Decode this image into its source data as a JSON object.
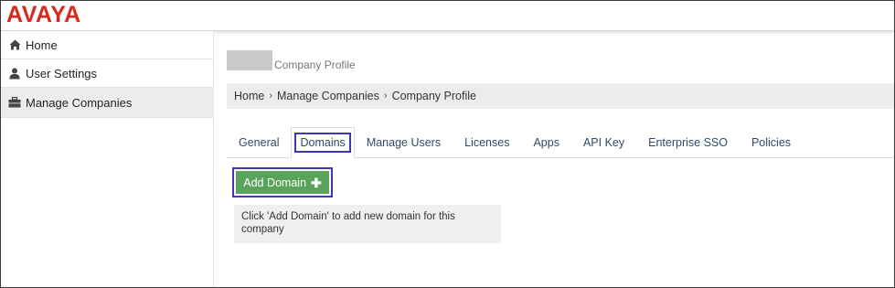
{
  "brand": {
    "logo_text": "AVAYA",
    "accent": "#da291c"
  },
  "sidebar": {
    "items": [
      {
        "label": "Home",
        "icon": "home-icon"
      },
      {
        "label": "User Settings",
        "icon": "user-icon"
      },
      {
        "label": "Manage Companies",
        "icon": "briefcase-icon",
        "active": true
      }
    ]
  },
  "header": {
    "company_title": "Company Profile"
  },
  "breadcrumb": {
    "items": [
      "Home",
      "Manage Companies",
      "Company Profile"
    ],
    "separator": "›"
  },
  "tabs": [
    {
      "label": "General"
    },
    {
      "label": "Domains",
      "active": true
    },
    {
      "label": "Manage Users"
    },
    {
      "label": "Licenses"
    },
    {
      "label": "Apps"
    },
    {
      "label": "API Key"
    },
    {
      "label": "Enterprise SSO"
    },
    {
      "label": "Policies"
    }
  ],
  "domains": {
    "add_button_label": "Add Domain",
    "add_button_icon": "plus-icon",
    "button_color": "#5aa35a",
    "highlight_color": "#3e38b8",
    "empty_hint": "Click 'Add Domain' to add new domain for this company"
  }
}
